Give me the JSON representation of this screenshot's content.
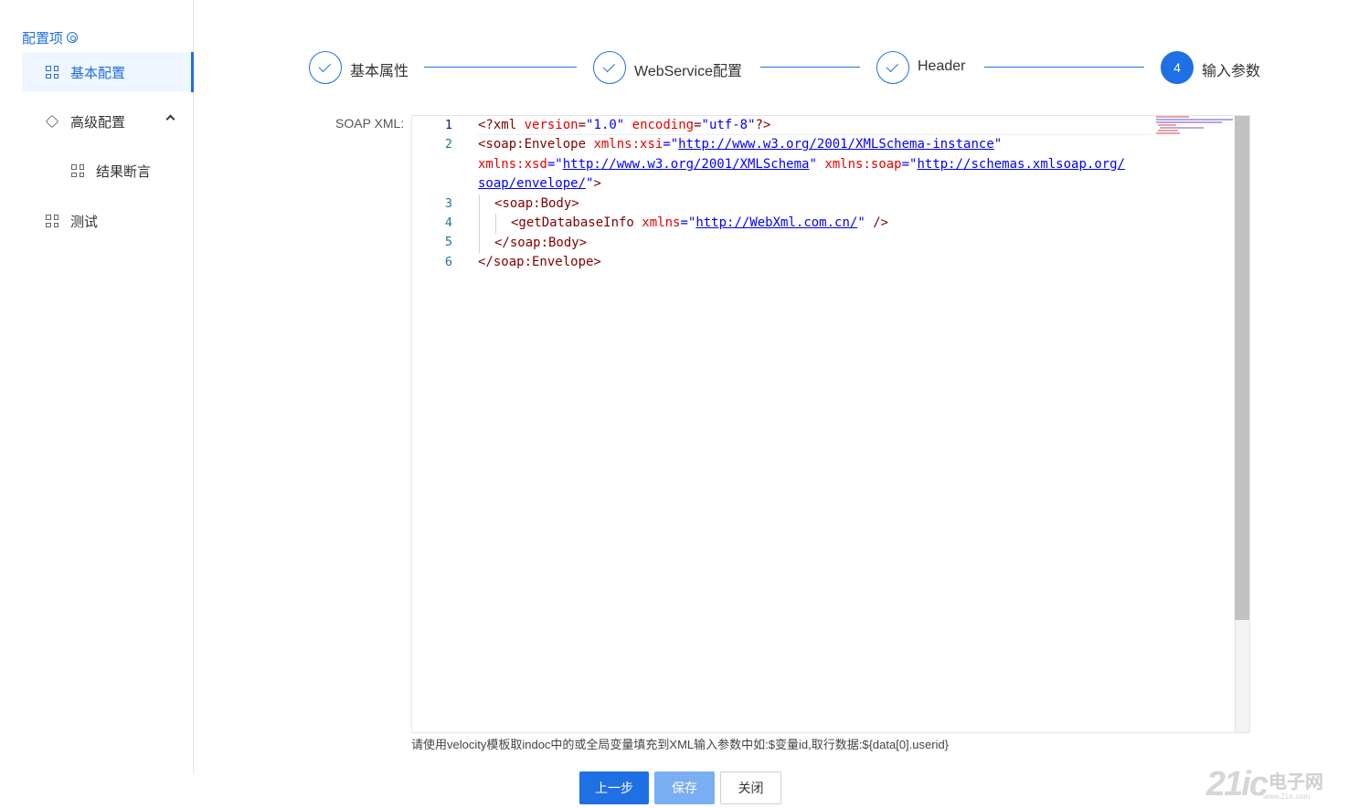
{
  "sidebar": {
    "title": "配置项",
    "items": [
      {
        "label": "基本配置",
        "active": true
      },
      {
        "label": "高级配置",
        "expanded": true
      },
      {
        "label": "结果断言"
      },
      {
        "label": "测试"
      }
    ]
  },
  "steps": [
    {
      "label": "基本属性",
      "status": "done"
    },
    {
      "label": "WebService配置",
      "status": "done"
    },
    {
      "label": "Header",
      "status": "done"
    },
    {
      "label": "输入参数",
      "status": "current",
      "number": "4"
    }
  ],
  "form": {
    "soap_label": "SOAP XML:",
    "line_numbers": [
      "1",
      "2",
      "3",
      "4",
      "5",
      "6"
    ],
    "hint": "请使用velocity模板取indoc中的或全局变量填充到XML输入参数中如:$变量id,取行数据:${data[0].userid}"
  },
  "code": {
    "l1": {
      "open": "<?",
      "name": "xml",
      "a1": "version",
      "v1": "\"1.0\"",
      "a2": "encoding",
      "v2": "\"utf-8\"",
      "close": "?>"
    },
    "l2a": {
      "open": "<soap:Envelope",
      "a1": "xmlns:xsi",
      "eq": "=\"",
      "url": "http://www.w3.org/2001/XMLSchema-instance",
      "q": "\""
    },
    "l2b": {
      "a1": "xmlns:xsd",
      "eq": "=\"",
      "url": "http://www.w3.org/2001/XMLSchema",
      "q": "\"",
      "a2": "xmlns:soap",
      "url2": "http://schemas.xmlsoap.org/"
    },
    "l2c": {
      "url": "soap/envelope/",
      "q": "\"",
      "close": ">"
    },
    "l3": "<soap:Body>",
    "l4": {
      "open": "<getDatabaseInfo",
      "a1": "xmlns",
      "eq": "=\"",
      "url": "http://WebXml.com.cn/",
      "q": "\"",
      "close": " />"
    },
    "l5": "</soap:Body>",
    "l6": "</soap:Envelope>"
  },
  "buttons": {
    "prev": "上一步",
    "save": "保存",
    "close": "关闭"
  },
  "watermark": {
    "num": "21ic",
    "text": "电子网",
    "sub": "www.21ic.com"
  },
  "colors": {
    "primary": "#1f6fe5",
    "save_disabled": "#7aaef2"
  }
}
